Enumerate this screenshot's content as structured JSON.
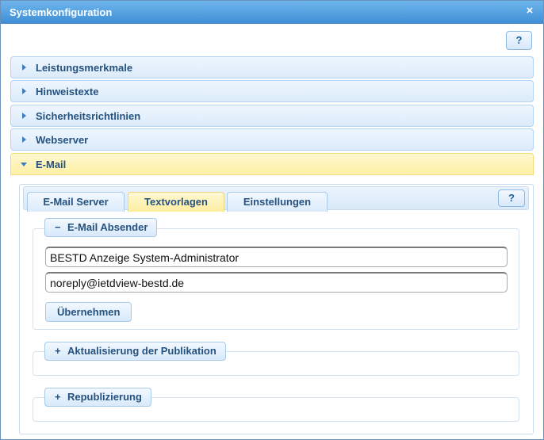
{
  "window": {
    "title": "Systemkonfiguration",
    "close_icon": "×",
    "help_label": "?"
  },
  "accordion": {
    "items": [
      {
        "label": "Leistungsmerkmale",
        "expanded": false
      },
      {
        "label": "Hinweistexte",
        "expanded": false
      },
      {
        "label": "Sicherheitsrichtlinien",
        "expanded": false
      },
      {
        "label": "Webserver",
        "expanded": false
      },
      {
        "label": "E-Mail",
        "expanded": true
      }
    ]
  },
  "email": {
    "tabs": [
      {
        "label": "E-Mail Server",
        "active": false
      },
      {
        "label": "Textvorlagen",
        "active": true
      },
      {
        "label": "Einstellungen",
        "active": false
      }
    ],
    "help_label": "?",
    "sender": {
      "legend": "E-Mail Absender",
      "legend_symbol": "−",
      "name_value": "BESTD Anzeige System-Administrator",
      "address_value": "noreply@ietdview-bestd.de",
      "apply_label": "Übernehmen"
    },
    "publication_update": {
      "legend": "Aktualisierung der Publikation",
      "legend_symbol": "+"
    },
    "republishing": {
      "legend": "Republizierung",
      "legend_symbol": "+"
    }
  },
  "colors": {
    "titlebar": "#4a9be0",
    "accordion_active": "#fdf0a6",
    "accordion_default": "#dcebfa",
    "label_text": "#26527f"
  }
}
